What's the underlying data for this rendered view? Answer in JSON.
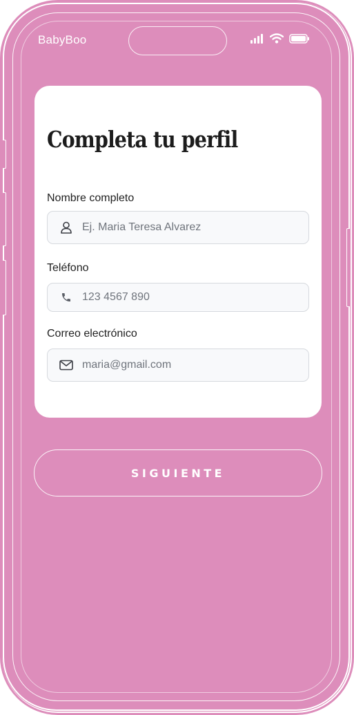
{
  "status_bar": {
    "app_name": "BabyBoo",
    "icons": [
      "signal-icon",
      "wifi-icon",
      "battery-icon"
    ]
  },
  "profile_form": {
    "title": "Completa tu perfil",
    "fields": [
      {
        "label": "Nombre completo",
        "placeholder": "Ej. Maria Teresa Alvarez",
        "value": "",
        "icon": "user-icon"
      },
      {
        "label": "Teléfono",
        "placeholder": "123 4567 890",
        "value": "",
        "icon": "phone-icon"
      },
      {
        "label": "Correo electrónico",
        "placeholder": "maria@gmail.com",
        "value": "",
        "icon": "mail-icon"
      }
    ]
  },
  "actions": {
    "next_label": "SIGUIENTE"
  },
  "colors": {
    "background": "#dd8dbb",
    "card": "#ffffff",
    "field_background": "#f8f9fb",
    "field_border": "#d6d9de",
    "text": "#1c1c1c"
  }
}
